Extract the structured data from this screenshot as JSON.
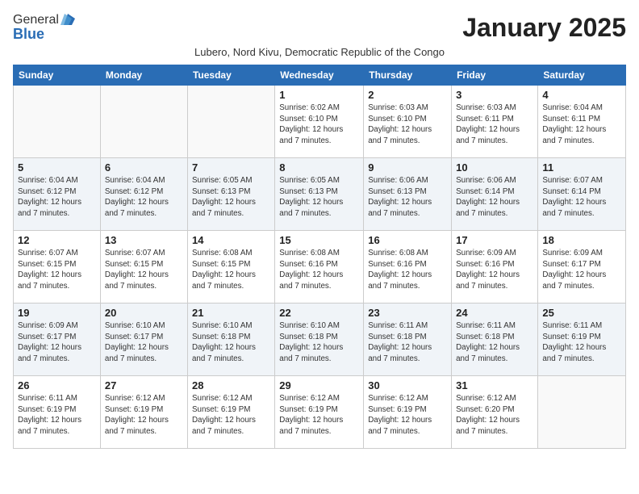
{
  "logo": {
    "general": "General",
    "blue": "Blue"
  },
  "title": "January 2025",
  "subtitle": "Lubero, Nord Kivu, Democratic Republic of the Congo",
  "weekdays": [
    "Sunday",
    "Monday",
    "Tuesday",
    "Wednesday",
    "Thursday",
    "Friday",
    "Saturday"
  ],
  "weeks": [
    [
      {
        "day": "",
        "info": ""
      },
      {
        "day": "",
        "info": ""
      },
      {
        "day": "",
        "info": ""
      },
      {
        "day": "1",
        "info": "Sunrise: 6:02 AM\nSunset: 6:10 PM\nDaylight: 12 hours\nand 7 minutes."
      },
      {
        "day": "2",
        "info": "Sunrise: 6:03 AM\nSunset: 6:10 PM\nDaylight: 12 hours\nand 7 minutes."
      },
      {
        "day": "3",
        "info": "Sunrise: 6:03 AM\nSunset: 6:11 PM\nDaylight: 12 hours\nand 7 minutes."
      },
      {
        "day": "4",
        "info": "Sunrise: 6:04 AM\nSunset: 6:11 PM\nDaylight: 12 hours\nand 7 minutes."
      }
    ],
    [
      {
        "day": "5",
        "info": "Sunrise: 6:04 AM\nSunset: 6:12 PM\nDaylight: 12 hours\nand 7 minutes."
      },
      {
        "day": "6",
        "info": "Sunrise: 6:04 AM\nSunset: 6:12 PM\nDaylight: 12 hours\nand 7 minutes."
      },
      {
        "day": "7",
        "info": "Sunrise: 6:05 AM\nSunset: 6:13 PM\nDaylight: 12 hours\nand 7 minutes."
      },
      {
        "day": "8",
        "info": "Sunrise: 6:05 AM\nSunset: 6:13 PM\nDaylight: 12 hours\nand 7 minutes."
      },
      {
        "day": "9",
        "info": "Sunrise: 6:06 AM\nSunset: 6:13 PM\nDaylight: 12 hours\nand 7 minutes."
      },
      {
        "day": "10",
        "info": "Sunrise: 6:06 AM\nSunset: 6:14 PM\nDaylight: 12 hours\nand 7 minutes."
      },
      {
        "day": "11",
        "info": "Sunrise: 6:07 AM\nSunset: 6:14 PM\nDaylight: 12 hours\nand 7 minutes."
      }
    ],
    [
      {
        "day": "12",
        "info": "Sunrise: 6:07 AM\nSunset: 6:15 PM\nDaylight: 12 hours\nand 7 minutes."
      },
      {
        "day": "13",
        "info": "Sunrise: 6:07 AM\nSunset: 6:15 PM\nDaylight: 12 hours\nand 7 minutes."
      },
      {
        "day": "14",
        "info": "Sunrise: 6:08 AM\nSunset: 6:15 PM\nDaylight: 12 hours\nand 7 minutes."
      },
      {
        "day": "15",
        "info": "Sunrise: 6:08 AM\nSunset: 6:16 PM\nDaylight: 12 hours\nand 7 minutes."
      },
      {
        "day": "16",
        "info": "Sunrise: 6:08 AM\nSunset: 6:16 PM\nDaylight: 12 hours\nand 7 minutes."
      },
      {
        "day": "17",
        "info": "Sunrise: 6:09 AM\nSunset: 6:16 PM\nDaylight: 12 hours\nand 7 minutes."
      },
      {
        "day": "18",
        "info": "Sunrise: 6:09 AM\nSunset: 6:17 PM\nDaylight: 12 hours\nand 7 minutes."
      }
    ],
    [
      {
        "day": "19",
        "info": "Sunrise: 6:09 AM\nSunset: 6:17 PM\nDaylight: 12 hours\nand 7 minutes."
      },
      {
        "day": "20",
        "info": "Sunrise: 6:10 AM\nSunset: 6:17 PM\nDaylight: 12 hours\nand 7 minutes."
      },
      {
        "day": "21",
        "info": "Sunrise: 6:10 AM\nSunset: 6:18 PM\nDaylight: 12 hours\nand 7 minutes."
      },
      {
        "day": "22",
        "info": "Sunrise: 6:10 AM\nSunset: 6:18 PM\nDaylight: 12 hours\nand 7 minutes."
      },
      {
        "day": "23",
        "info": "Sunrise: 6:11 AM\nSunset: 6:18 PM\nDaylight: 12 hours\nand 7 minutes."
      },
      {
        "day": "24",
        "info": "Sunrise: 6:11 AM\nSunset: 6:18 PM\nDaylight: 12 hours\nand 7 minutes."
      },
      {
        "day": "25",
        "info": "Sunrise: 6:11 AM\nSunset: 6:19 PM\nDaylight: 12 hours\nand 7 minutes."
      }
    ],
    [
      {
        "day": "26",
        "info": "Sunrise: 6:11 AM\nSunset: 6:19 PM\nDaylight: 12 hours\nand 7 minutes."
      },
      {
        "day": "27",
        "info": "Sunrise: 6:12 AM\nSunset: 6:19 PM\nDaylight: 12 hours\nand 7 minutes."
      },
      {
        "day": "28",
        "info": "Sunrise: 6:12 AM\nSunset: 6:19 PM\nDaylight: 12 hours\nand 7 minutes."
      },
      {
        "day": "29",
        "info": "Sunrise: 6:12 AM\nSunset: 6:19 PM\nDaylight: 12 hours\nand 7 minutes."
      },
      {
        "day": "30",
        "info": "Sunrise: 6:12 AM\nSunset: 6:19 PM\nDaylight: 12 hours\nand 7 minutes."
      },
      {
        "day": "31",
        "info": "Sunrise: 6:12 AM\nSunset: 6:20 PM\nDaylight: 12 hours\nand 7 minutes."
      },
      {
        "day": "",
        "info": ""
      }
    ]
  ]
}
